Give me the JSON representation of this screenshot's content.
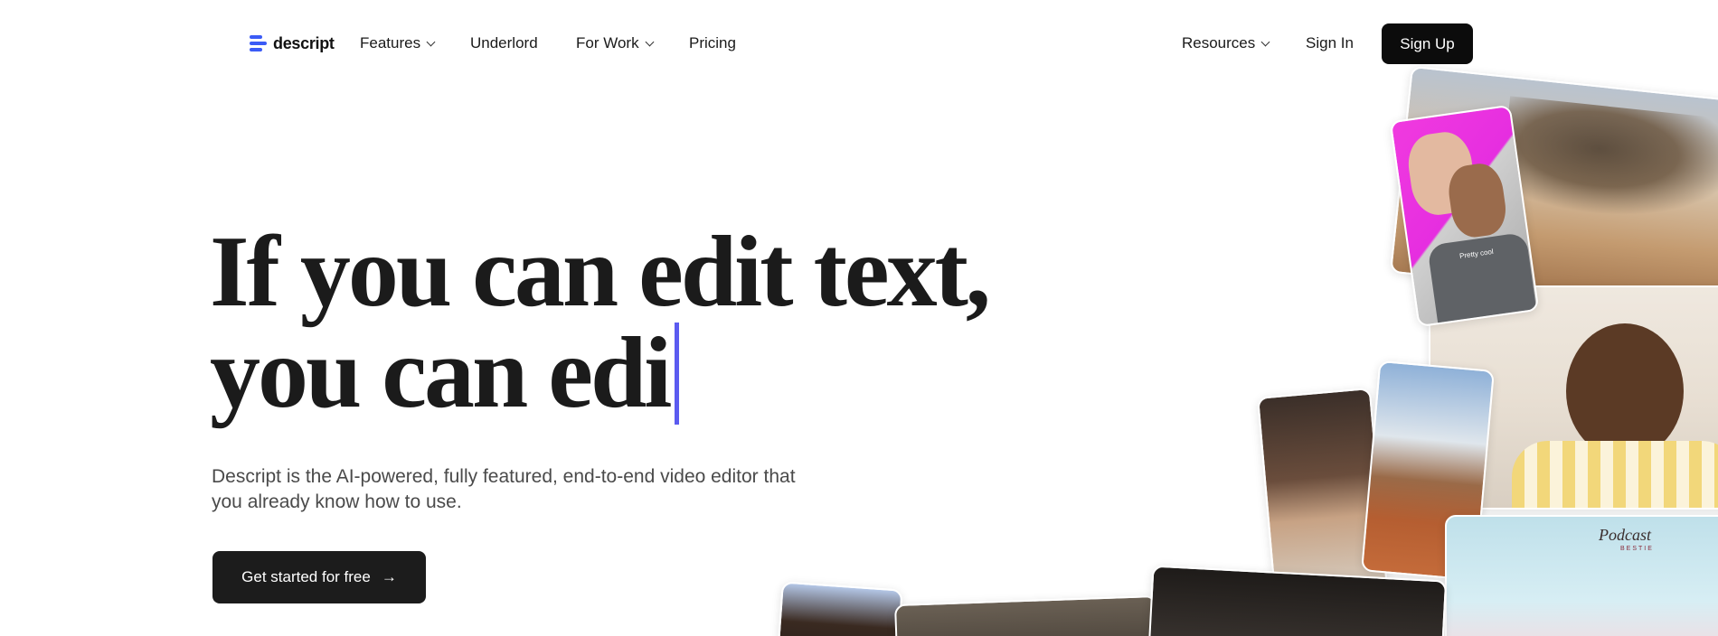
{
  "nav": {
    "brand": "descript",
    "features": "Features",
    "underlord": "Underlord",
    "for_work": "For Work",
    "pricing": "Pricing",
    "resources": "Resources",
    "sign_in": "Sign In",
    "sign_up": "Sign Up"
  },
  "hero": {
    "line1": "If you can edit text,",
    "line2": "you can edi",
    "subtitle": "Descript is the AI-powered, fully featured, end-to-end video editor that you already know how to use.",
    "cta": "Get started for free",
    "cta_icon": "arrow-right-icon"
  },
  "collage": {
    "podcast_logo": "Podcast",
    "podcast_sublogo": "BESTIE",
    "duo_caption": "Pretty cool"
  },
  "colors": {
    "accent": "#3b5bf6",
    "caret": "#5b5bf0",
    "button_bg": "#0c0c0c"
  }
}
